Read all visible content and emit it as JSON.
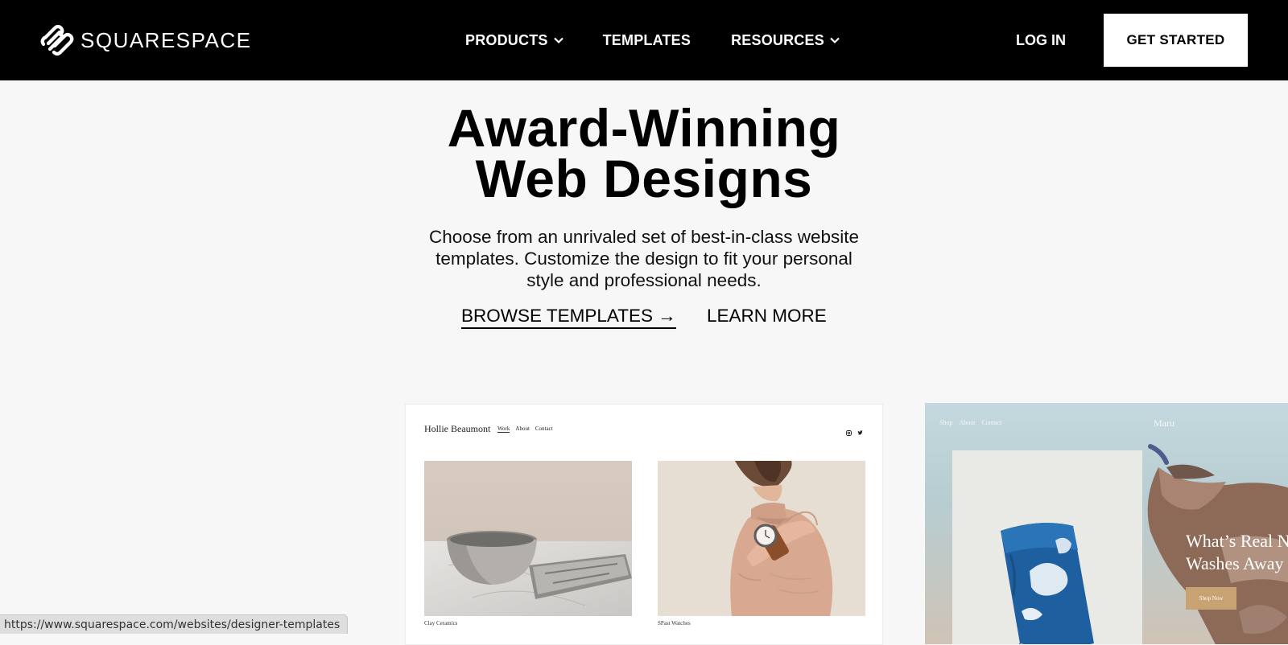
{
  "nav": {
    "logo_text": "SQUARESPACE",
    "products_label": "PRODUCTS",
    "templates_label": "TEMPLATES",
    "resources_label": "RESOURCES",
    "login_label": "LOG IN",
    "get_started_label": "GET STARTED"
  },
  "hero": {
    "title_line1": "Award-Winning",
    "title_line2": "Web Designs",
    "subtitle_line1": "Choose from an unrivaled set of best-in-class website",
    "subtitle_line2": "templates. Customize the design to fit your personal",
    "subtitle_line3": "style and professional needs.",
    "browse_label": "BROWSE TEMPLATES →",
    "learn_label": "LEARN MORE"
  },
  "template_cards": [
    {
      "brand": "Hollie Beaumont",
      "menu": [
        "Work",
        "About",
        "Contact"
      ],
      "captions": [
        "Clay Ceramics",
        "SPast Watches"
      ]
    },
    {
      "brand": "Maru",
      "menu": [
        "Shop",
        "About",
        "Contact"
      ],
      "headline_line1": "What’s Real N",
      "headline_line2": "Washes Away",
      "button_label": "Shop Now"
    }
  ],
  "status_bar": {
    "url": "https://www.squarespace.com/websites/designer-templates"
  },
  "colors": {
    "nav_bg": "#000000",
    "page_bg": "#f7f7f7",
    "accent_button": "#c9a273"
  },
  "icons": [
    "squarespace-logo-icon",
    "chevron-down-icon",
    "instagram-icon",
    "twitter-icon"
  ]
}
